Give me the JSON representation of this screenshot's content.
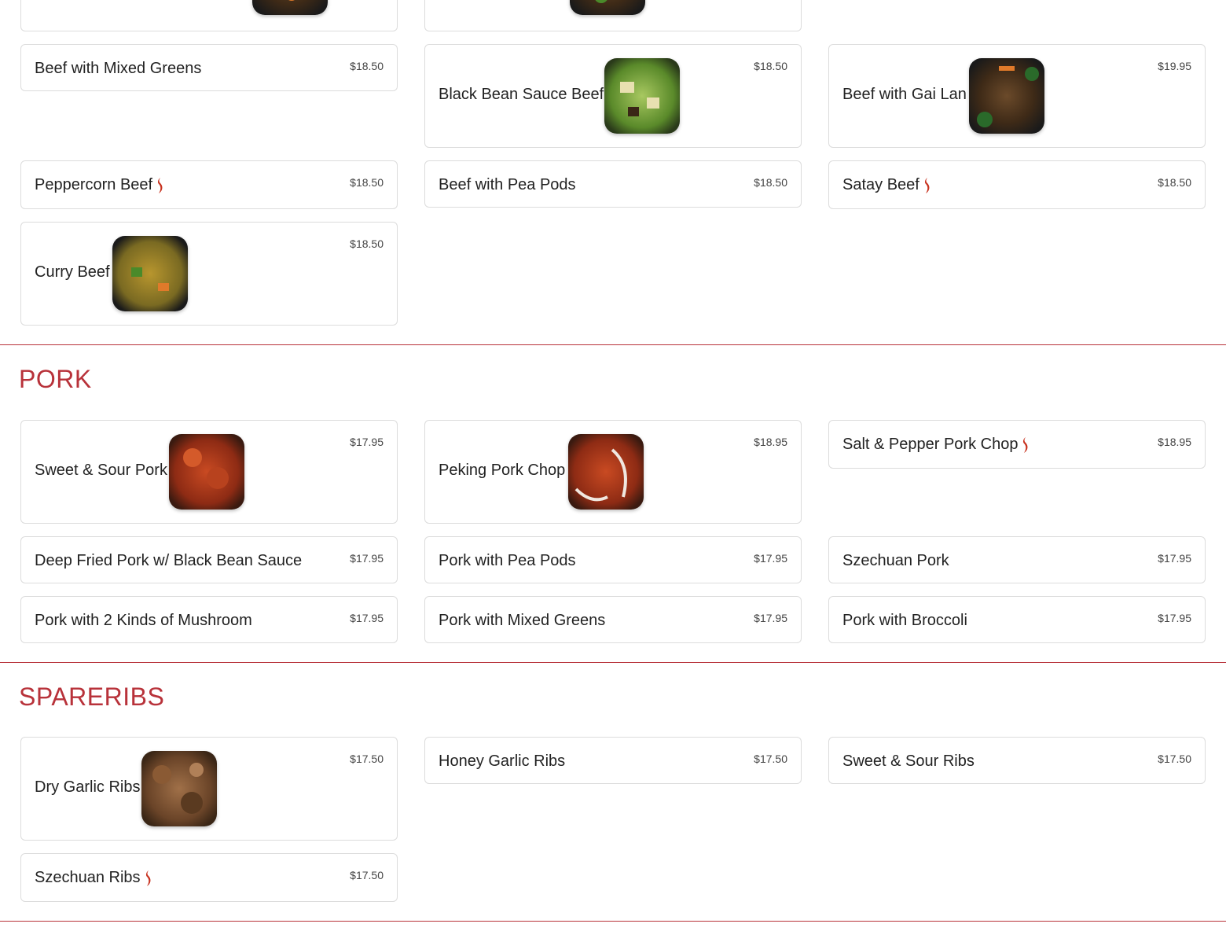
{
  "colors": {
    "accent": "#b8323a",
    "border": "#dcdcdc",
    "chili": "#c8321f"
  },
  "top_partial_cards": [
    {
      "id": "partial-1"
    },
    {
      "id": "partial-2"
    }
  ],
  "beef_items": [
    {
      "name": "Beef with Mixed Greens",
      "price": "$18.50",
      "spicy": false
    },
    {
      "name": "Black Bean Sauce Beef",
      "price": "$18.50",
      "spicy": false
    },
    {
      "name": "Beef with Gai Lan",
      "price": "$19.95",
      "spicy": false
    },
    {
      "name": "Peppercorn Beef",
      "price": "$18.50",
      "spicy": true
    },
    {
      "name": "Beef with Pea Pods",
      "price": "$18.50",
      "spicy": false
    },
    {
      "name": "Satay Beef",
      "price": "$18.50",
      "spicy": true
    },
    {
      "name": "Curry Beef",
      "price": "$18.50",
      "spicy": false
    }
  ],
  "pork": {
    "title": "PORK",
    "items": [
      {
        "name": "Sweet & Sour Pork",
        "price": "$17.95",
        "spicy": false
      },
      {
        "name": "Peking Pork Chop",
        "price": "$18.95",
        "spicy": false
      },
      {
        "name": "Salt & Pepper Pork Chop",
        "price": "$18.95",
        "spicy": true
      },
      {
        "name": "Deep Fried Pork w/ Black Bean Sauce",
        "price": "$17.95",
        "spicy": false
      },
      {
        "name": "Pork with Pea Pods",
        "price": "$17.95",
        "spicy": false
      },
      {
        "name": "Szechuan Pork",
        "price": "$17.95",
        "spicy": false
      },
      {
        "name": "Pork with 2 Kinds of Mushroom",
        "price": "$17.95",
        "spicy": false
      },
      {
        "name": "Pork with Mixed Greens",
        "price": "$17.95",
        "spicy": false
      },
      {
        "name": "Pork with Broccoli",
        "price": "$17.95",
        "spicy": false
      }
    ]
  },
  "spareribs": {
    "title": "SPARERIBS",
    "items": [
      {
        "name": "Dry Garlic Ribs",
        "price": "$17.50",
        "spicy": false
      },
      {
        "name": "Honey Garlic Ribs",
        "price": "$17.50",
        "spicy": false
      },
      {
        "name": "Sweet & Sour Ribs",
        "price": "$17.50",
        "spicy": false
      },
      {
        "name": "Szechuan Ribs",
        "price": "$17.50",
        "spicy": true
      }
    ]
  }
}
